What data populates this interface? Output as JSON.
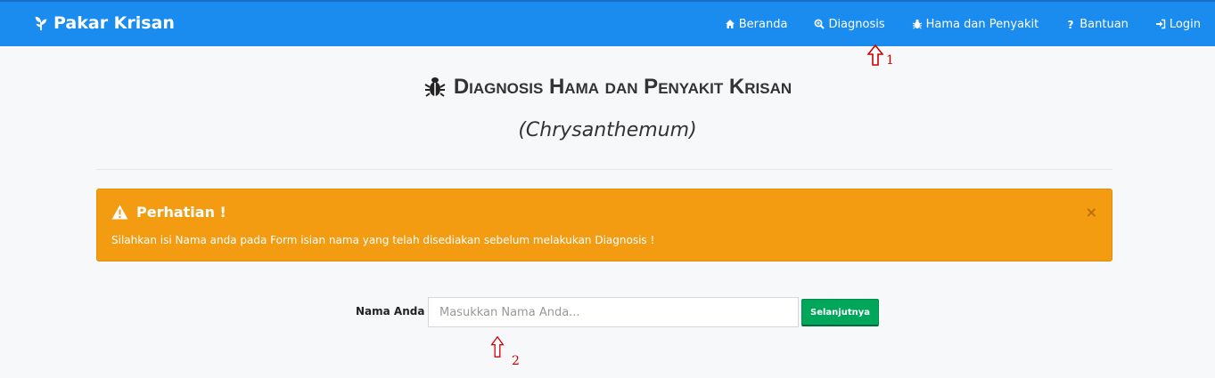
{
  "navbar": {
    "brand": "Pakar Krisan",
    "items": [
      {
        "label": "Beranda",
        "icon": "home-icon"
      },
      {
        "label": "Diagnosis",
        "icon": "search-plus-icon"
      },
      {
        "label": "Hama dan Penyakit",
        "icon": "bug-icon"
      },
      {
        "label": "Bantuan",
        "icon": "question-icon"
      },
      {
        "label": "Login",
        "icon": "sign-in-icon"
      }
    ]
  },
  "main": {
    "title": "Diagnosis Hama dan Penyakit Krisan",
    "subtitle": "(Chrysanthemum)"
  },
  "alert": {
    "heading": "Perhatian !",
    "message": "Silahkan isi Nama anda pada Form isian nama yang telah disediakan sebelum melakukan Diagnosis !",
    "close": "×"
  },
  "form": {
    "label": "Nama Anda :",
    "placeholder": "Masukkan Nama Anda...",
    "value": "",
    "submit": "Selanjutnya"
  },
  "annotations": [
    "1",
    "2"
  ],
  "colors": {
    "navbar": "#1a8cf0",
    "alert": "#f39c12",
    "button": "#00a65a",
    "annotation": "#cc0000"
  }
}
